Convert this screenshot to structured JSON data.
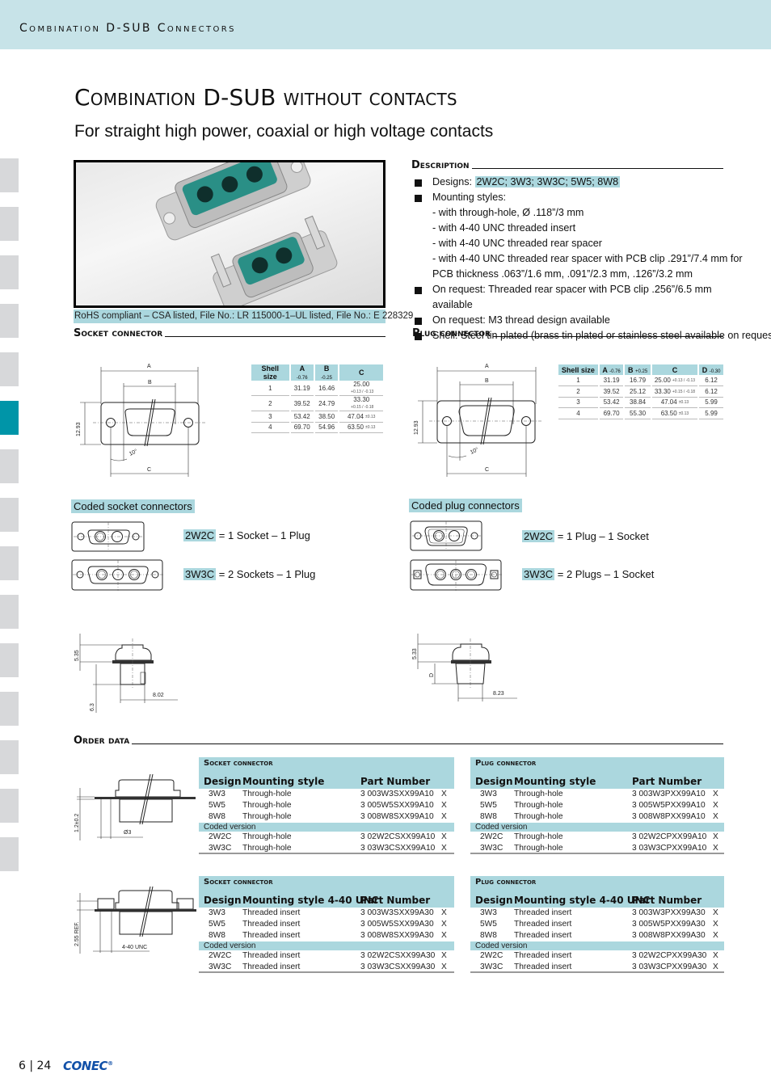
{
  "header": {
    "section_title": "Combination D-SUB Connectors"
  },
  "side_tabs": {
    "count": 15,
    "active_index": 5,
    "active_color": "#0095a8",
    "inactive_color": "#d7d8da"
  },
  "page": {
    "title": "Combination D-SUB without contacts",
    "subtitle": "For straight high power, coaxial or high voltage contacts"
  },
  "photo": {
    "alt": "product-photo-combination-dsub-connectors",
    "caption": "RoHS compliant – CSA listed, File No.: LR 115000-1–UL listed, File No.: E 228329"
  },
  "description": {
    "heading": "Description",
    "designs_label": "Designs: ",
    "designs_value": "2W2C; 3W3; 3W3C; 5W5; 8W8",
    "mounting_label": "Mounting styles:",
    "mounting_items": [
      "- with through-hole, Ø .118”/3 mm",
      "- with 4-40 UNC threaded insert",
      "- with 4-40 UNC threaded rear spacer",
      "- with 4-40 UNC threaded rear spacer with PCB clip .291”/7.4 mm for",
      "PCB thickness .063”/1.6 mm, .091”/2.3 mm, .126”/3.2 mm"
    ],
    "bullets": [
      "On request: Threaded rear spacer with PCB clip .256”/6.5 mm available",
      "On request: M3 thread design available",
      "Shell: Steel tin plated (brass tin plated or stainless steel available on request)"
    ]
  },
  "socket_section": {
    "heading": "Socket connector",
    "drawing_labels": {
      "a": "A",
      "b": "B",
      "c": "C",
      "height": "12.93",
      "angle": "10°"
    },
    "table": {
      "headers": [
        "Shell size",
        "A",
        "B",
        "C"
      ],
      "header_tolerances": [
        "",
        "-0.76",
        "-0.25",
        ""
      ],
      "rows": [
        [
          "1",
          "31.19",
          "16.46",
          "25.00",
          "+0.13 / -0.13"
        ],
        [
          "2",
          "39.52",
          "24.79",
          "33.30",
          "+0.15 / -0.18"
        ],
        [
          "3",
          "53.42",
          "38.50",
          "47.04",
          "±0.13"
        ],
        [
          "4",
          "69.70",
          "54.96",
          "63.50",
          "±0.13"
        ]
      ]
    },
    "coded_label": "Coded socket connectors",
    "coded": [
      {
        "code": "2W2C",
        "text": " = 1 Socket – 1 Plug"
      },
      {
        "code": "3W3C",
        "text": " = 2 Sockets – 1 Plug"
      }
    ],
    "side_labels": {
      "top": "5.35",
      "bottom": "6.3",
      "width": "8.02"
    }
  },
  "plug_section": {
    "heading": "Plug connector",
    "drawing_labels": {
      "a": "A",
      "b": "B",
      "c": "C",
      "height": "12.93",
      "angle": "10°"
    },
    "table": {
      "headers": [
        "Shell size",
        "A",
        "B",
        "C",
        "D"
      ],
      "header_tolerances": [
        "",
        "-0.76",
        "+0.25",
        "",
        "-0.30"
      ],
      "rows": [
        [
          "1",
          "31.19",
          "16.79",
          "25.00",
          "+0.13 / -0.13",
          "6.12"
        ],
        [
          "2",
          "39.52",
          "25.12",
          "33.30",
          "+0.15 / -0.18",
          "6.12"
        ],
        [
          "3",
          "53.42",
          "38.84",
          "47.04",
          "±0.13",
          "5.99"
        ],
        [
          "4",
          "69.70",
          "55.30",
          "63.50",
          "±0.13",
          "5.99"
        ]
      ]
    },
    "coded_label": "Coded plug connectors",
    "coded": [
      {
        "code": "2W2C",
        "text": " = 1 Plug – 1 Socket"
      },
      {
        "code": "3W3C",
        "text": " = 2 Plugs – 1 Socket"
      }
    ],
    "side_labels": {
      "top": "5.33",
      "d": "D",
      "width": "8.23"
    }
  },
  "order": {
    "heading": "Order data",
    "drawing_labels": {
      "through_h": "1.2±0.2",
      "through_d": "Ø3",
      "thread_h": "2.55 REF.",
      "thread": "4-40 UNC"
    },
    "coded_version": "Coded version",
    "tables": [
      {
        "caption": "Socket connector",
        "cols": [
          "Design",
          "Mounting style",
          "Part Number"
        ],
        "rows": [
          [
            "3W3",
            "Through-hole",
            "3 003W3SXX99A10",
            "X"
          ],
          [
            "5W5",
            "Through-hole",
            "3 005W5SXX99A10",
            "X"
          ],
          [
            "8W8",
            "Through-hole",
            "3 008W8SXX99A10",
            "X"
          ]
        ],
        "coded_rows": [
          [
            "2W2C",
            "Through-hole",
            "3 02W2CSXX99A10",
            "X"
          ],
          [
            "3W3C",
            "Through-hole",
            "3 03W3CSXX99A10",
            "X"
          ]
        ]
      },
      {
        "caption": "Plug connector",
        "cols": [
          "Design",
          "Mounting style",
          "Part Number"
        ],
        "rows": [
          [
            "3W3",
            "Through-hole",
            "3 003W3PXX99A10",
            "X"
          ],
          [
            "5W5",
            "Through-hole",
            "3 005W5PXX99A10",
            "X"
          ],
          [
            "8W8",
            "Through-hole",
            "3 008W8PXX99A10",
            "X"
          ]
        ],
        "coded_rows": [
          [
            "2W2C",
            "Through-hole",
            "3 02W2CPXX99A10",
            "X"
          ],
          [
            "3W3C",
            "Through-hole",
            "3 03W3CPXX99A10",
            "X"
          ]
        ]
      },
      {
        "caption": "Socket connector",
        "cols": [
          "Design",
          "Mounting style 4-40 UNC",
          "Part Number"
        ],
        "rows": [
          [
            "3W3",
            "Threaded insert",
            "3 003W3SXX99A30",
            "X"
          ],
          [
            "5W5",
            "Threaded insert",
            "3 005W5SXX99A30",
            "X"
          ],
          [
            "8W8",
            "Threaded insert",
            "3 008W8SXX99A30",
            "X"
          ]
        ],
        "coded_rows": [
          [
            "2W2C",
            "Threaded insert",
            "3 02W2CSXX99A30",
            "X"
          ],
          [
            "3W3C",
            "Threaded insert",
            "3 03W3CSXX99A30",
            "X"
          ]
        ]
      },
      {
        "caption": "Plug connector",
        "cols": [
          "Design",
          "Mounting style 4-40 UNC",
          "Part Number"
        ],
        "rows": [
          [
            "3W3",
            "Threaded insert",
            "3 003W3PXX99A30",
            "X"
          ],
          [
            "5W5",
            "Threaded insert",
            "3 005W5PXX99A30",
            "X"
          ],
          [
            "8W8",
            "Threaded insert",
            "3 008W8PXX99A30",
            "X"
          ]
        ],
        "coded_rows": [
          [
            "2W2C",
            "Threaded insert",
            "3 02W2CPXX99A30",
            "X"
          ],
          [
            "3W3C",
            "Threaded insert",
            "3 03W3CPXX99A30",
            "X"
          ]
        ]
      }
    ]
  },
  "footer": {
    "page": "6 | 24",
    "logo": "CONEC"
  },
  "colors": {
    "highlight": "#abd7de",
    "header_band": "#c7e3e8",
    "brand_blue": "#1150a8",
    "teal_insert": "#2a8f86"
  }
}
